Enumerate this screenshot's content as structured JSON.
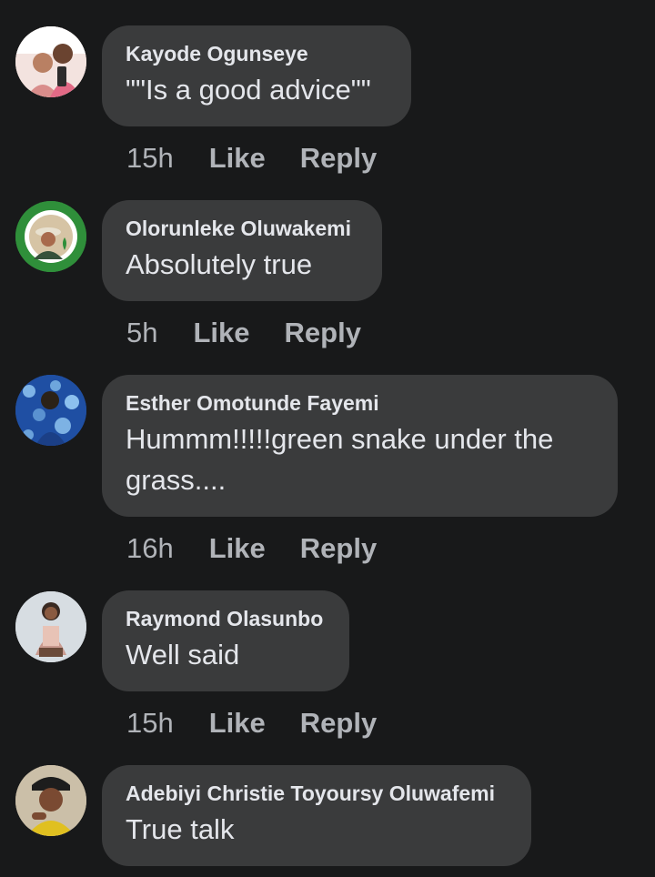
{
  "comments": [
    {
      "author": "Kayode Ogunseye",
      "text": "\"\"Is a good advice\"\"",
      "time": "15h",
      "like_label": "Like",
      "reply_label": "Reply",
      "avatar_icon": "user-photo-avatar"
    },
    {
      "author": "Olorunleke Oluwakemi",
      "text": "Absolutely true",
      "time": "5h",
      "like_label": "Like",
      "reply_label": "Reply",
      "avatar_icon": "user-photo-avatar"
    },
    {
      "author": "Esther Omotunde Fayemi",
      "text": "Hummm!!!!!green snake under the grass....",
      "time": "16h",
      "like_label": "Like",
      "reply_label": "Reply",
      "avatar_icon": "user-photo-avatar"
    },
    {
      "author": "Raymond Olasunbo",
      "text": "Well said",
      "time": "15h",
      "like_label": "Like",
      "reply_label": "Reply",
      "avatar_icon": "user-photo-avatar"
    },
    {
      "author": "Adebiyi Christie Toyoursy Oluwafemi",
      "text": "True talk",
      "avatar_icon": "user-photo-avatar"
    }
  ],
  "colors": {
    "background": "#18191a",
    "bubble": "#3a3b3c",
    "primary_text": "#e4e6eb",
    "secondary_text": "#b0b3b8"
  }
}
